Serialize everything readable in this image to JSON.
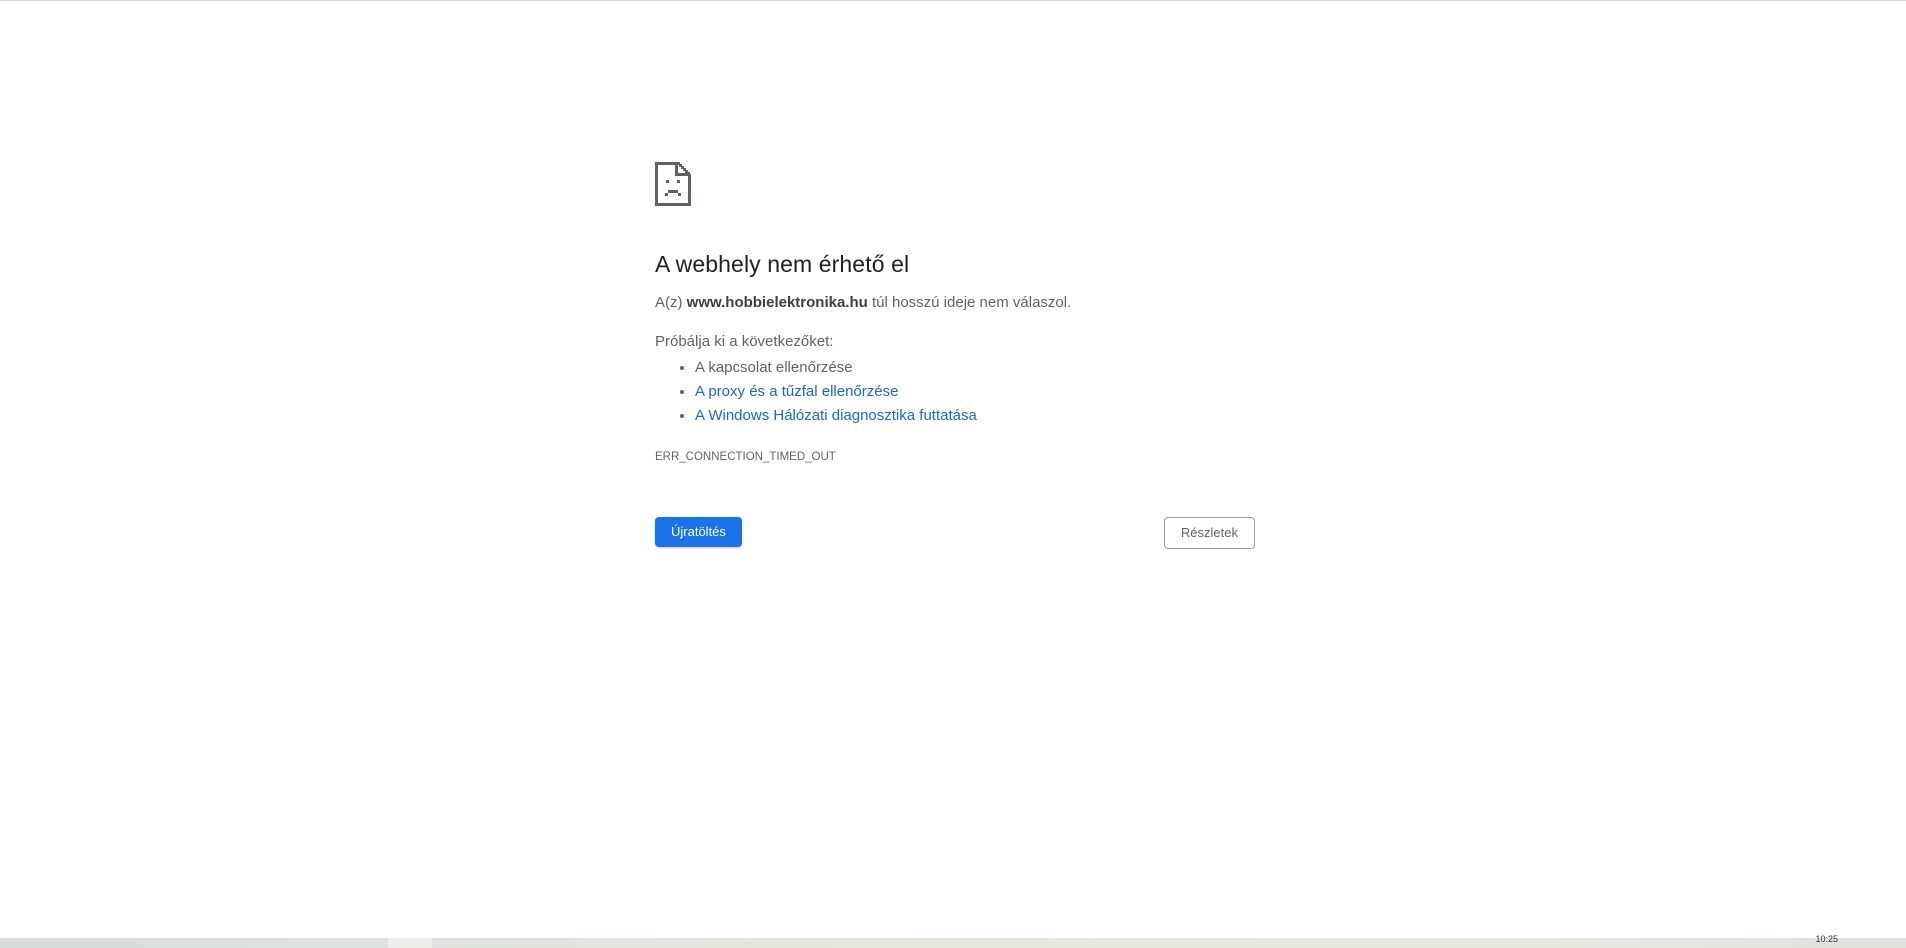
{
  "error_page": {
    "icon": "sad-document-icon",
    "title": "A webhely nem érhető el",
    "summary_prefix": "A(z) ",
    "summary_host": "www.hobbielektronika.hu",
    "summary_suffix": " túl hosszú ideje nem válaszol.",
    "suggestions_intro": "Próbálja ki a következőket:",
    "suggestions": [
      "A kapcsolat ellenőrzése",
      "A proxy és a tűzfal ellenőrzése",
      "A Windows Hálózati diagnosztika futtatása"
    ],
    "error_code": "ERR_CONNECTION_TIMED_OUT",
    "reload_label": "Újratöltés",
    "details_label": "Részletek"
  },
  "taskbar": {
    "clock": "10:25"
  },
  "colors": {
    "accent": "#1a73e8",
    "link": "#1967d2",
    "text": "#5f6368",
    "heading": "#202124"
  }
}
